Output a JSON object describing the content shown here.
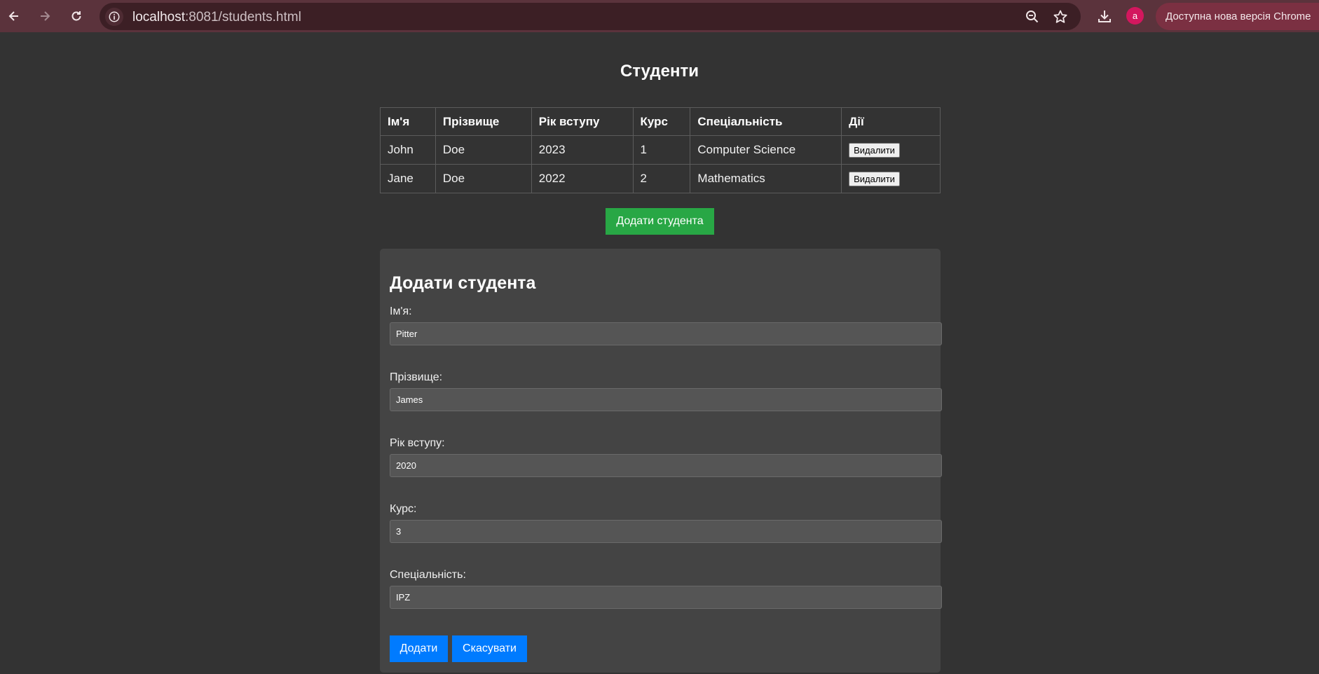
{
  "browser": {
    "url_host": "localhost",
    "url_port_path": ":8081/students.html",
    "profile_initial": "a",
    "update_text": "Доступна нова версія Chrome"
  },
  "page": {
    "title": "Студенти"
  },
  "table": {
    "headers": [
      "Ім'я",
      "Прізвище",
      "Рік вступу",
      "Курс",
      "Спеціальність",
      "Дії"
    ],
    "rows": [
      {
        "first_name": "John",
        "last_name": "Doe",
        "year": "2023",
        "course": "1",
        "specialty": "Computer Science",
        "action": "Видалити"
      },
      {
        "first_name": "Jane",
        "last_name": "Doe",
        "year": "2022",
        "course": "2",
        "specialty": "Mathematics",
        "action": "Видалити"
      }
    ]
  },
  "add_button": "Додати студента",
  "form": {
    "title": "Додати студента",
    "fields": [
      {
        "label": "Ім'я:",
        "value": "Pitter"
      },
      {
        "label": "Прізвище:",
        "value": "James"
      },
      {
        "label": "Рік вступу:",
        "value": "2020"
      },
      {
        "label": "Курс:",
        "value": "3"
      },
      {
        "label": "Спеціальність:",
        "value": "IPZ"
      }
    ],
    "submit_label": "Додати",
    "cancel_label": "Скасувати"
  },
  "colors": {
    "add_button": "#28a745",
    "form_buttons": "#007bff",
    "page_bg": "#333333",
    "panel_bg": "#444444"
  }
}
